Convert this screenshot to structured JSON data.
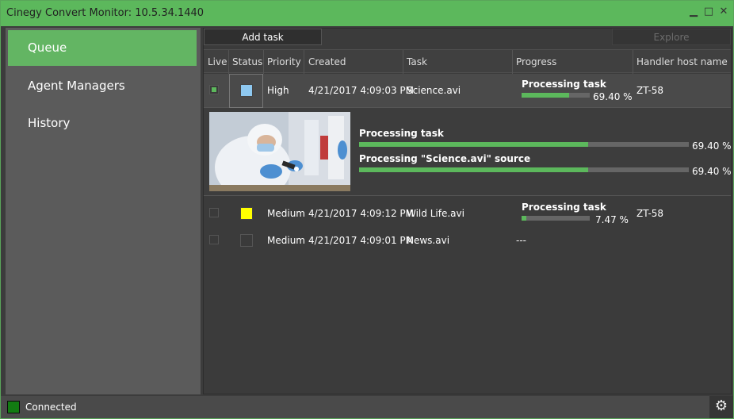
{
  "window": {
    "title": "Cinegy Convert Monitor: 10.5.34.1440",
    "minimize_glyph": "▁",
    "maximize_glyph": "□",
    "close_glyph": "✕"
  },
  "sidebar": {
    "items": [
      {
        "label": "Queue",
        "active": true
      },
      {
        "label": "Agent Managers",
        "active": false
      },
      {
        "label": "History",
        "active": false
      }
    ]
  },
  "toolbar": {
    "add_task": "Add task",
    "explore": "Explore"
  },
  "table": {
    "columns": [
      "Live",
      "Status",
      "Priority",
      "Created",
      "Task",
      "Progress",
      "Handler host name"
    ],
    "rows": [
      {
        "live": true,
        "status_color": "#8ec8f0",
        "priority": "High",
        "created": "4/21/2017 4:09:03 PM",
        "task": "Science.avi",
        "progress_title": "Processing task",
        "progress_value": 69.4,
        "progress_text": "69.40 %",
        "handler": "ZT-58"
      },
      {
        "live": false,
        "status_color": "#ffff00",
        "priority": "Medium",
        "created": "4/21/2017 4:09:12 PM",
        "task": "Wild Life.avi",
        "progress_title": "Processing task",
        "progress_value": 7.47,
        "progress_text": "7.47 %",
        "handler": "ZT-58"
      },
      {
        "live": false,
        "status_color": "#3a3a3a",
        "priority": "Medium",
        "created": "4/21/2017 4:09:01 PM",
        "task": "News.avi",
        "progress_text": "---",
        "handler": ""
      }
    ],
    "detail": [
      {
        "title": "Processing task",
        "value": 69.4,
        "text": "69.40 %"
      },
      {
        "title": "Processing \"Science.avi\" source",
        "value": 69.4,
        "text": "69.40 %"
      }
    ]
  },
  "status": {
    "text": "Connected",
    "led_color": "#127c12",
    "gear_icon": "gear-icon"
  },
  "colors": {
    "accent": "#5cb85c",
    "background": "#3c3c3c"
  }
}
